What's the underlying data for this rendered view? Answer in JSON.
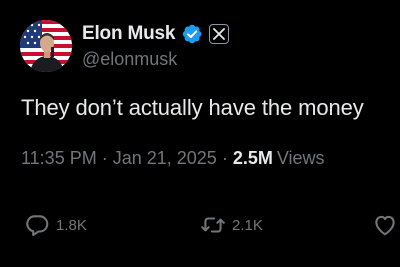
{
  "author": {
    "display_name": "Elon Musk",
    "handle": "@elonmusk",
    "verified_icon": "verified-badge-icon",
    "affiliate_icon": "x-logo-icon"
  },
  "tweet": {
    "text": "They don’t actually have the money",
    "time": "11:35 PM",
    "date": "Jan 21, 2025",
    "separator": "·",
    "views_count": "2.5M",
    "views_label": "Views"
  },
  "actions": {
    "reply": {
      "icon": "reply-icon",
      "count": "1.8K"
    },
    "repost": {
      "icon": "repost-icon",
      "count": "2.1K"
    },
    "like": {
      "icon": "like-icon"
    }
  },
  "colors": {
    "background": "#000000",
    "primary_text": "#e7e9ea",
    "secondary_text": "#71767b",
    "verified_blue": "#1d9bf0"
  }
}
